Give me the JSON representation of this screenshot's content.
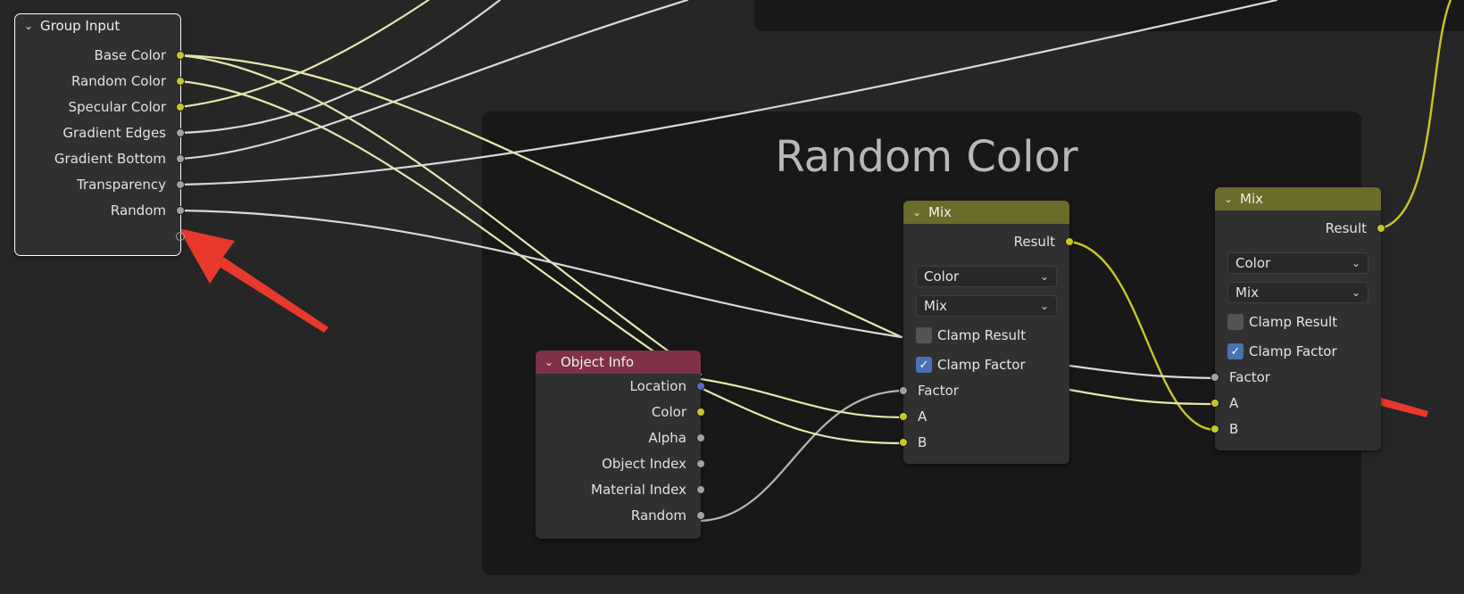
{
  "group_input": {
    "title": "Group Input",
    "outputs": [
      "Base Color",
      "Random Color",
      "Specular Color",
      "Gradient Edges",
      "Gradient Bottom",
      "Transparency",
      "Random"
    ]
  },
  "frame": {
    "label": "Random Color"
  },
  "object_info": {
    "title": "Object Info",
    "outputs": [
      "Location",
      "Color",
      "Alpha",
      "Object Index",
      "Material Index",
      "Random"
    ]
  },
  "mix1": {
    "title": "Mix",
    "result_label": "Result",
    "data_type": "Color",
    "blend_mode": "Mix",
    "clamp_result_label": "Clamp Result",
    "clamp_result_checked": false,
    "clamp_factor_label": "Clamp Factor",
    "clamp_factor_checked": true,
    "inputs": [
      "Factor",
      "A",
      "B"
    ]
  },
  "mix2": {
    "title": "Mix",
    "result_label": "Result",
    "data_type": "Color",
    "blend_mode": "Mix",
    "clamp_result_label": "Clamp Result",
    "clamp_result_checked": false,
    "clamp_factor_label": "Clamp Factor",
    "clamp_factor_checked": true,
    "inputs": [
      "Factor",
      "A",
      "B"
    ]
  },
  "colors": {
    "background": "#262626",
    "frame": "#181818",
    "group_header": "#303030",
    "mix_header": "#6b6b2a",
    "object_info_header": "#803047",
    "socket_color": "#c7c729",
    "socket_float": "#a1a1a1",
    "socket_vector": "#6363c7",
    "annotation_arrow": "#e8392c"
  }
}
